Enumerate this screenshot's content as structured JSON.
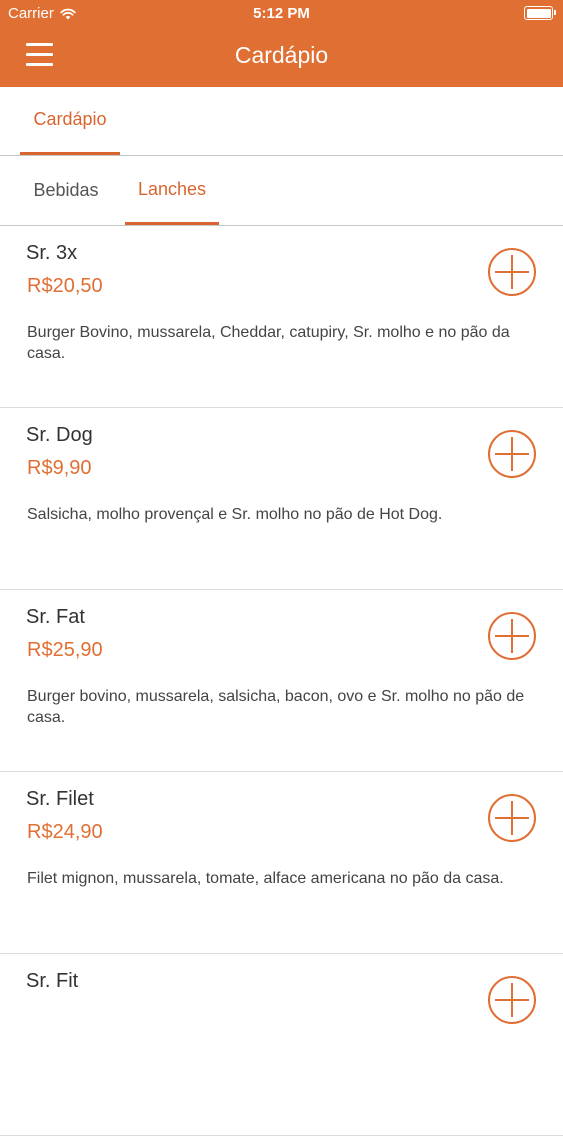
{
  "status_bar": {
    "carrier": "Carrier",
    "time": "5:12 PM"
  },
  "header": {
    "title": "Cardápio"
  },
  "tabs_primary": {
    "items": [
      {
        "label": "Cardápio",
        "active": true
      }
    ]
  },
  "tabs_secondary": {
    "items": [
      {
        "label": "Bebidas",
        "active": false
      },
      {
        "label": "Lanches",
        "active": true
      }
    ]
  },
  "menu_items": [
    {
      "name": "Sr. 3x",
      "price": "R$20,50",
      "description": "Burger Bovino, mussarela, Cheddar, catupiry, Sr. molho e no pão da casa."
    },
    {
      "name": "Sr. Dog",
      "price": "R$9,90",
      "description": "Salsicha, molho provençal e Sr. molho no pão de Hot Dog."
    },
    {
      "name": "Sr. Fat",
      "price": "R$25,90",
      "description": "Burger bovino, mussarela, salsicha, bacon, ovo e Sr. molho no pão de casa."
    },
    {
      "name": "Sr. Filet",
      "price": "R$24,90",
      "description": "Filet mignon, mussarela, tomate, alface americana no pão da casa."
    },
    {
      "name": "Sr. Fit",
      "price": "",
      "description": ""
    }
  ],
  "colors": {
    "brand": "#e06f33",
    "accent": "#d8652f"
  },
  "icons": {
    "menu": "hamburger-menu-icon",
    "add": "plus-circle-icon",
    "wifi": "wifi-icon",
    "battery": "battery-icon"
  }
}
